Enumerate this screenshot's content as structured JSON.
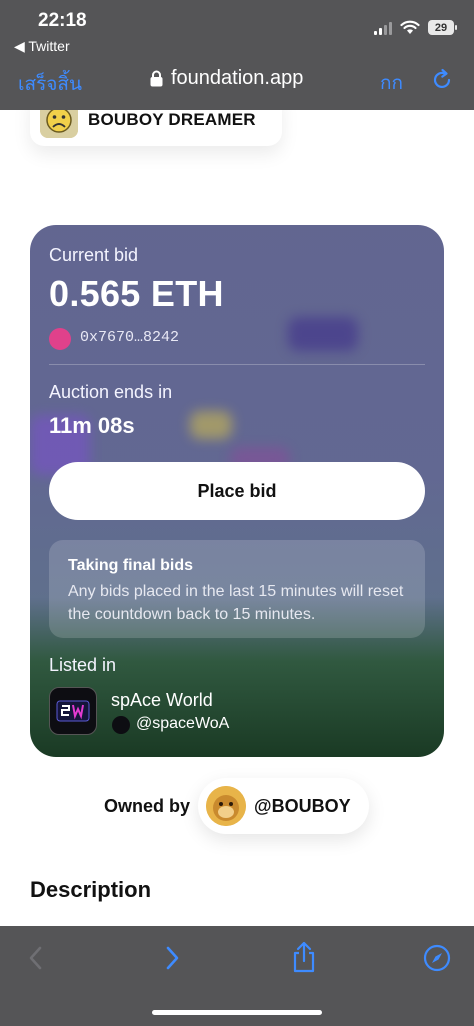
{
  "status_bar": {
    "time": "22:18",
    "back_app": "◀ Twitter",
    "battery": "29"
  },
  "browser": {
    "done_label": "เสร็จสิ้น",
    "url": "foundation.app",
    "text_size_label": "กก"
  },
  "creator": {
    "name": "BOUBOY DREAMER"
  },
  "auction": {
    "current_bid_label": "Current bid",
    "current_bid": "0.565 ETH",
    "bidder_address": "0x7670…8242",
    "ends_label": "Auction ends in",
    "time_left": "11m 08s",
    "place_bid_label": "Place bid",
    "notice_title": "Taking final bids",
    "notice_body": "Any bids placed in the last 15 minutes will reset the countdown back to 15 minutes.",
    "listed_in_label": "Listed in",
    "collection_name": "spAce World",
    "collection_handle": "@spaceWoA"
  },
  "owner": {
    "label": "Owned by",
    "handle": "@BOUBOY"
  },
  "description_heading": "Description",
  "toolbar": {
    "back": "chevron-left-icon",
    "forward": "chevron-right-icon",
    "share": "share-icon",
    "compass": "compass-icon"
  },
  "colors": {
    "accent": "#3e8bff",
    "chrome": "#555557",
    "bidder": "#e0418b"
  }
}
